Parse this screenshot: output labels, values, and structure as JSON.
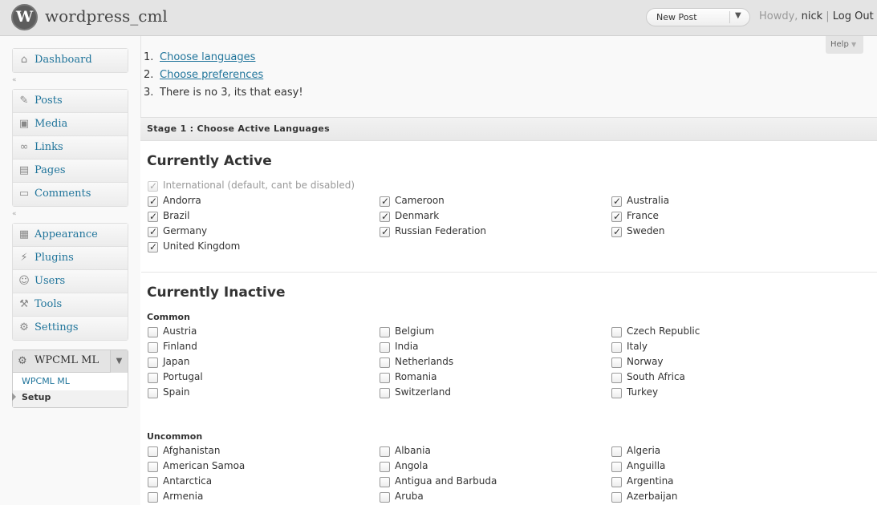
{
  "header": {
    "logo_letter": "W",
    "site_title": "wordpress_cml",
    "new_post_label": "New Post",
    "howdy": "Howdy,",
    "username": "nick",
    "separator": "|",
    "logout_label": "Log Out"
  },
  "help_label": "Help",
  "sidebar": {
    "group1": [
      {
        "label": "Dashboard",
        "icon": "home-icon"
      }
    ],
    "group2": [
      {
        "label": "Posts",
        "icon": "pin-icon"
      },
      {
        "label": "Media",
        "icon": "media-icon"
      },
      {
        "label": "Links",
        "icon": "link-icon"
      },
      {
        "label": "Pages",
        "icon": "page-icon"
      },
      {
        "label": "Comments",
        "icon": "comment-icon"
      }
    ],
    "group3": [
      {
        "label": "Appearance",
        "icon": "appearance-icon"
      },
      {
        "label": "Plugins",
        "icon": "plugin-icon"
      },
      {
        "label": "Users",
        "icon": "users-icon"
      },
      {
        "label": "Tools",
        "icon": "tools-icon"
      },
      {
        "label": "Settings",
        "icon": "settings-icon"
      }
    ],
    "wpcml": {
      "label": "WPCML ML",
      "sub_items": [
        "WPCML ML",
        "Setup"
      ]
    }
  },
  "steps": [
    {
      "num": "1.",
      "label": "Choose languages"
    },
    {
      "num": "2.",
      "label": "Choose preferences"
    },
    {
      "num": "3.",
      "label": "There is no 3, its that easy!"
    }
  ],
  "stage_title": "Stage 1 : Choose Active Languages",
  "active": {
    "title": "Currently Active",
    "international": "International (default, cant be disabled)",
    "columns": [
      [
        "Andorra",
        "Brazil",
        "Germany",
        "United Kingdom"
      ],
      [
        "Cameroon",
        "Denmark",
        "Russian Federation"
      ],
      [
        "Australia",
        "France",
        "Sweden"
      ]
    ]
  },
  "inactive": {
    "title": "Currently Inactive",
    "common_label": "Common",
    "common_columns": [
      [
        "Austria",
        "Finland",
        "Japan",
        "Portugal",
        "Spain"
      ],
      [
        "Belgium",
        "India",
        "Netherlands",
        "Romania",
        "Switzerland"
      ],
      [
        "Czech Republic",
        "Italy",
        "Norway",
        "South Africa",
        "Turkey"
      ]
    ],
    "uncommon_label": "Uncommon",
    "uncommon_columns": [
      [
        "Afghanistan",
        "American Samoa",
        "Antarctica",
        "Armenia"
      ],
      [
        "Albania",
        "Angola",
        "Antigua and Barbuda",
        "Aruba"
      ],
      [
        "Algeria",
        "Anguilla",
        "Argentina",
        "Azerbaijan"
      ]
    ]
  }
}
